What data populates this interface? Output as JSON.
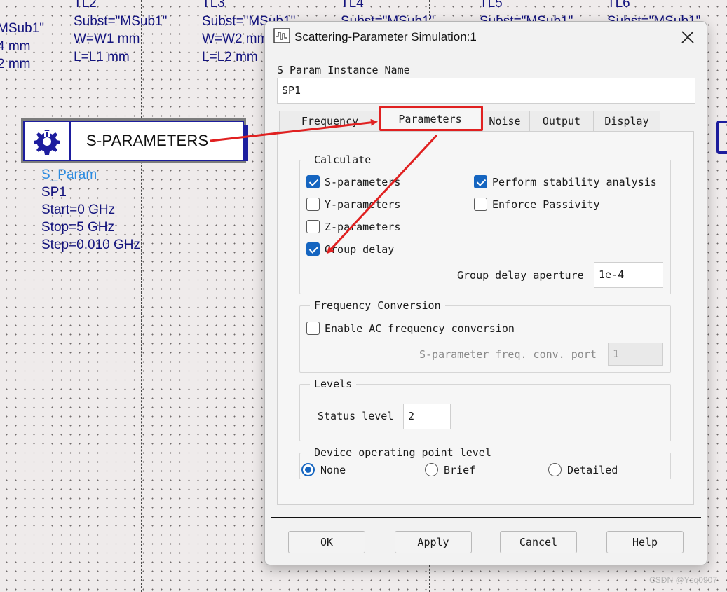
{
  "schematic": {
    "columns": [
      {
        "lines": [
          "MSub1\"",
          "4 mm",
          "2 mm"
        ]
      },
      {
        "lines": [
          "TL2",
          "Subst=\"MSub1\"",
          "W=W1 mm",
          "L=L1 mm"
        ]
      },
      {
        "lines": [
          "TL3",
          "Subst=\"MSub1\"",
          "W=W2 mm",
          "L=L2 mm"
        ]
      },
      {
        "lines": [
          "TL4",
          "Subst=\"MSub1\""
        ]
      },
      {
        "lines": [
          "TL5",
          "Subst=\"MSub1\""
        ]
      },
      {
        "lines": [
          "TL6",
          "Subst=\"MSub1\""
        ]
      }
    ],
    "component": {
      "title": "S-PARAMETERS",
      "icon": "simulation-gear-icon",
      "type_label": "S_Param",
      "instance": "SP1",
      "props": [
        "Start=0 GHz",
        "Stop=5 GHz",
        "Step=0.010 GHz"
      ]
    }
  },
  "dialog": {
    "title": "Scattering-Parameter Simulation:1",
    "title_icon": "waveform-icon",
    "close_icon": "close-icon",
    "instance_label": "S_Param Instance Name",
    "instance_value": "SP1",
    "tabs": [
      "Frequency",
      "Parameters",
      "Noise",
      "Output",
      "Display"
    ],
    "active_tab": "Parameters",
    "calculate": {
      "label": "Calculate",
      "s_params": {
        "label": "S-parameters",
        "checked": true
      },
      "y_params": {
        "label": "Y-parameters",
        "checked": false
      },
      "z_params": {
        "label": "Z-parameters",
        "checked": false
      },
      "group_delay": {
        "label": "Group delay",
        "checked": true
      },
      "stability": {
        "label": "Perform stability analysis",
        "checked": true
      },
      "passivity": {
        "label": "Enforce Passivity",
        "checked": false
      },
      "aperture_label": "Group delay aperture",
      "aperture_value": "1e-4"
    },
    "freq_conversion": {
      "label": "Frequency Conversion",
      "enable_label": "Enable AC frequency conversion",
      "enable_checked": false,
      "port_label": "S-parameter freq. conv. port",
      "port_value": "1"
    },
    "levels": {
      "label": "Levels",
      "status_label": "Status level",
      "status_value": "2"
    },
    "op_point": {
      "label": "Device operating point level",
      "options": [
        "None",
        "Brief",
        "Detailed"
      ],
      "selected": "None"
    },
    "buttons": {
      "ok": "OK",
      "apply": "Apply",
      "cancel": "Cancel",
      "help": "Help"
    }
  },
  "annotation_color": "#e02020",
  "accent_color": "#1565c0",
  "schematic_text_color": "#13137d",
  "watermark": "CSDN @Ysq0907"
}
